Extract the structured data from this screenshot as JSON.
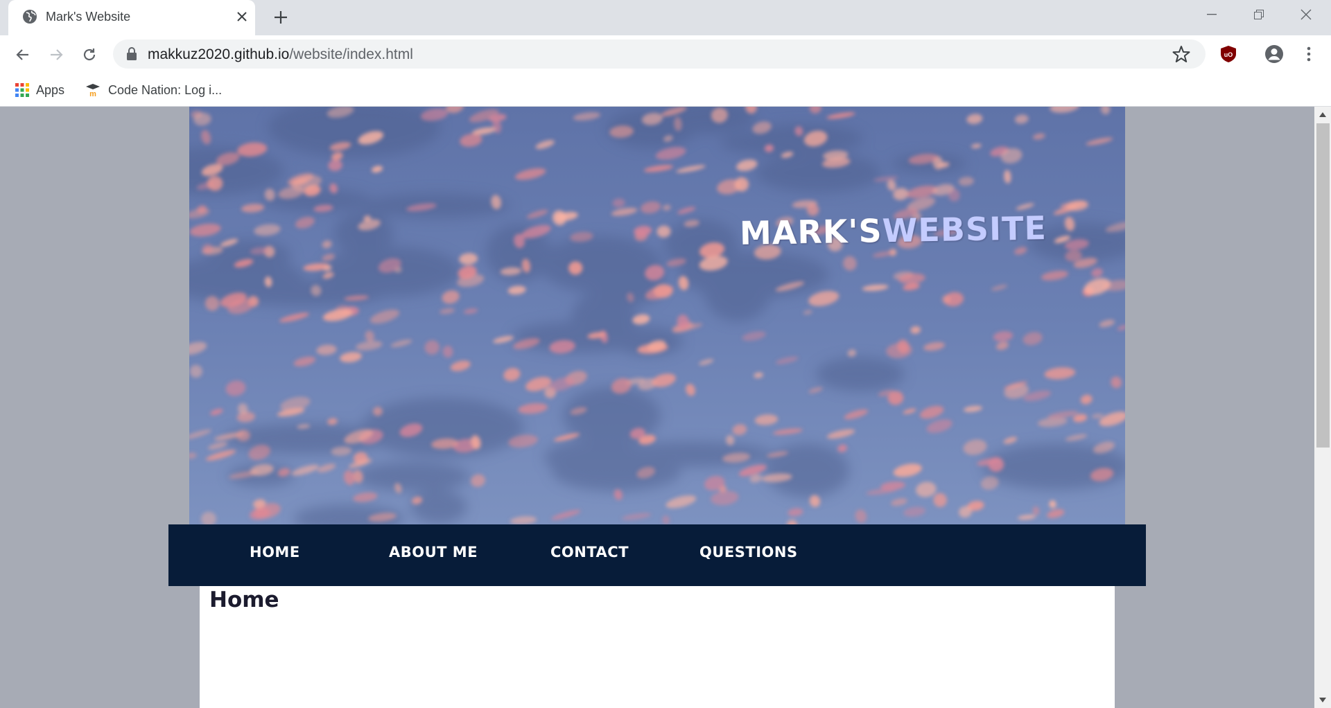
{
  "browser": {
    "tab_title": "Mark's Website",
    "url_host": "makkuz2020.github.io",
    "url_path": "/website/index.html",
    "bookmarks": [
      {
        "label": "Apps",
        "icon": "apps-grid-icon"
      },
      {
        "label": "Code Nation: Log i...",
        "icon": "code-nation-icon"
      }
    ]
  },
  "site": {
    "title_part1": "MARK'S",
    "title_part2": "WEBSITE",
    "nav": [
      "HOME",
      "ABOUT ME",
      "CONTACT",
      "QUESTIONS"
    ],
    "content_heading": "Home"
  },
  "colors": {
    "page_background": "#a7abb5",
    "navbar": "#071c39",
    "title_accent": "#c4ccff",
    "sky_blue": "#6d84b5",
    "cloud_pink": "#f3938c"
  }
}
